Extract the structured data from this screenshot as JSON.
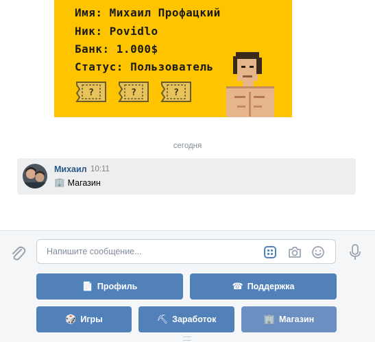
{
  "card": {
    "lines": [
      "Имя: Михаил Профацкий",
      "Ник: Povidlo",
      "Банк: 1.000$",
      "Статус: Пользователь"
    ],
    "ticket_mark": "?",
    "background": "#ffc400"
  },
  "date_divider": "сегодня",
  "message": {
    "author": "Михаил",
    "time": "10:11",
    "icon": "🏢",
    "text": "Магазин"
  },
  "composer": {
    "placeholder": "Напишите сообщение..."
  },
  "keyboard": {
    "profile": {
      "icon": "📄",
      "label": "Профиль"
    },
    "support": {
      "icon": "☎",
      "label": "Поддержка"
    },
    "games": {
      "icon": "🎲",
      "label": "Игры"
    },
    "earnings": {
      "icon": "⛏",
      "label": "Заработок"
    },
    "shop": {
      "icon": "🏢",
      "label": "Магазин"
    }
  },
  "colors": {
    "accent": "#5181b8",
    "link": "#2a5885",
    "muted": "#818c99"
  }
}
